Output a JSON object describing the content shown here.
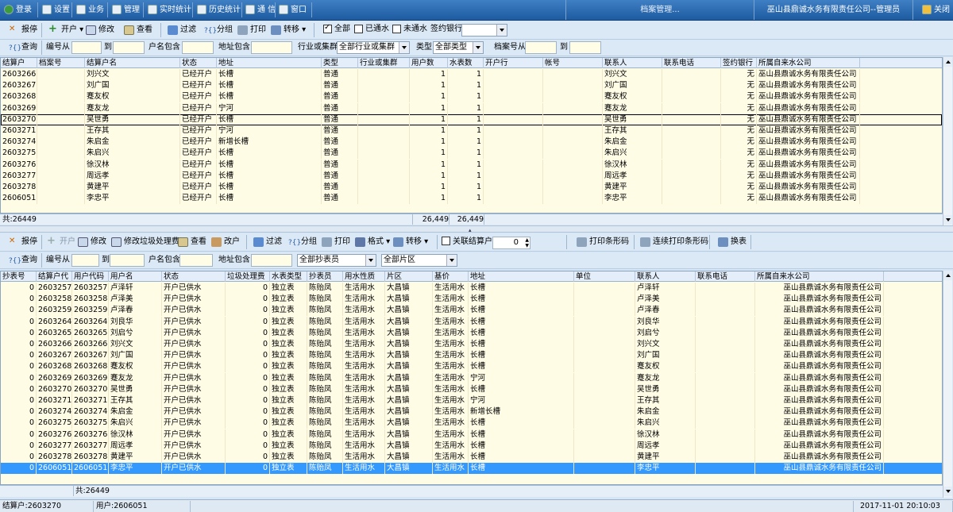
{
  "menu": {
    "login": "登录",
    "settings": "设置",
    "business": "业务",
    "manage": "管理",
    "realtime": "实时统计",
    "history": "历史统计",
    "comm": "通 信",
    "window": "窗口",
    "title": "档案管理...",
    "user": "巫山县鼎诚水务有限责任公司--管理员",
    "close": "关闭"
  },
  "top_toolbar": {
    "report_stop": "报停",
    "open": "开户",
    "modify": "修改",
    "view": "查看",
    "filter": "过滤",
    "group": "分组",
    "print": "打印",
    "transfer": "转移",
    "all": "全部",
    "connected": "已通水",
    "not_connected": "未通水",
    "sign_bank": "签约银行"
  },
  "top_query": {
    "query": "查询",
    "num_from": "编号从",
    "to": "到",
    "name_contains": "户名包含",
    "addr_contains": "地址包含",
    "industry": "行业或集群",
    "industry_value": "全部行业或集群",
    "type": "类型",
    "type_value": "全部类型",
    "archive_from": "档案号从",
    "to2": "到"
  },
  "top_grid": {
    "columns": [
      "结算户",
      "档案号",
      "结算户名",
      "状态",
      "地址",
      "类型",
      "行业或集群",
      "用户数",
      "水表数",
      "开户行",
      "帐号",
      "联系人",
      "联系电话",
      "签约银行",
      "所属自来水公司"
    ],
    "rows": [
      [
        "2603266",
        "",
        "刘兴文",
        "已经开户",
        "长槽",
        "普通",
        "",
        "1",
        "1",
        "",
        "",
        "刘兴文",
        "",
        "无",
        "巫山县鼎诚水务有限责任公司"
      ],
      [
        "2603267",
        "",
        "刘广国",
        "已经开户",
        "长槽",
        "普通",
        "",
        "1",
        "1",
        "",
        "",
        "刘广国",
        "",
        "无",
        "巫山县鼎诚水务有限责任公司"
      ],
      [
        "2603268",
        "",
        "蹇友权",
        "已经开户",
        "长槽",
        "普通",
        "",
        "1",
        "1",
        "",
        "",
        "蹇友权",
        "",
        "无",
        "巫山县鼎诚水务有限责任公司"
      ],
      [
        "2603269",
        "",
        "蹇友龙",
        "已经开户",
        "宁河",
        "普通",
        "",
        "1",
        "1",
        "",
        "",
        "蹇友龙",
        "",
        "无",
        "巫山县鼎诚水务有限责任公司"
      ],
      [
        "2603270",
        "",
        "吴世勇",
        "已经开户",
        "长槽",
        "普通",
        "",
        "1",
        "1",
        "",
        "",
        "吴世勇",
        "",
        "无",
        "巫山县鼎诚水务有限责任公司"
      ],
      [
        "2603271",
        "",
        "王存其",
        "已经开户",
        "宁河",
        "普通",
        "",
        "1",
        "1",
        "",
        "",
        "王存其",
        "",
        "无",
        "巫山县鼎诚水务有限责任公司"
      ],
      [
        "2603274",
        "",
        "朱启金",
        "已经开户",
        "新增长槽",
        "普通",
        "",
        "1",
        "1",
        "",
        "",
        "朱启金",
        "",
        "无",
        "巫山县鼎诚水务有限责任公司"
      ],
      [
        "2603275",
        "",
        "朱启兴",
        "已经开户",
        "长槽",
        "普通",
        "",
        "1",
        "1",
        "",
        "",
        "朱启兴",
        "",
        "无",
        "巫山县鼎诚水务有限责任公司"
      ],
      [
        "2603276",
        "",
        "徐汉林",
        "已经开户",
        "长槽",
        "普通",
        "",
        "1",
        "1",
        "",
        "",
        "徐汉林",
        "",
        "无",
        "巫山县鼎诚水务有限责任公司"
      ],
      [
        "2603277",
        "",
        "周远孝",
        "已经开户",
        "长槽",
        "普通",
        "",
        "1",
        "1",
        "",
        "",
        "周远孝",
        "",
        "无",
        "巫山县鼎诚水务有限责任公司"
      ],
      [
        "2603278",
        "",
        "黄建平",
        "已经开户",
        "长槽",
        "普通",
        "",
        "1",
        "1",
        "",
        "",
        "黄建平",
        "",
        "无",
        "巫山县鼎诚水务有限责任公司"
      ],
      [
        "2606051",
        "",
        "李忠平",
        "已经开户",
        "长槽",
        "普通",
        "",
        "1",
        "1",
        "",
        "",
        "李忠平",
        "",
        "无",
        "巫山县鼎诚水务有限责任公司"
      ]
    ],
    "footer_count": "共:26449",
    "footer_users": "26,449",
    "footer_meters": "26,449"
  },
  "bottom_toolbar": {
    "report_stop": "报停",
    "open": "开户",
    "modify": "修改",
    "modify_garbage": "修改垃圾处理费",
    "view": "查看",
    "change_user": "改户",
    "filter": "过滤",
    "group": "分组",
    "print": "打印",
    "format": "格式",
    "transfer": "转移",
    "link_account": "关联结算户",
    "link_value": "0",
    "print_barcode": "打印条形码",
    "batch_barcode": "连续打印条形码",
    "swap": "换表"
  },
  "bottom_query": {
    "query": "查询",
    "num_from": "编号从",
    "to": "到",
    "name_contains": "户名包含",
    "addr_contains": "地址包含",
    "readers": "全部抄表员",
    "areas": "全部片区"
  },
  "bottom_grid": {
    "columns": [
      "抄表号",
      "结算户代",
      "用户代码",
      "用户名",
      "状态",
      "垃圾处理费",
      "水表类型",
      "抄表员",
      "用水性质",
      "片区",
      "基价",
      "地址",
      "单位",
      "联系人",
      "联系电话",
      "所属自来水公司"
    ],
    "rows": [
      [
        "0",
        "2603257",
        "2603257",
        "卢泽轩",
        "开户已供水",
        "0",
        "独立表",
        "陈贻凤",
        "生活用水",
        "大昌镇",
        "生活用水",
        "长槽",
        "",
        "卢泽轩",
        "",
        "巫山县鼎诚水务有限责任公司"
      ],
      [
        "0",
        "2603258",
        "2603258",
        "卢泽美",
        "开户已供水",
        "0",
        "独立表",
        "陈贻凤",
        "生活用水",
        "大昌镇",
        "生活用水",
        "长槽",
        "",
        "卢泽美",
        "",
        "巫山县鼎诚水务有限责任公司"
      ],
      [
        "0",
        "2603259",
        "2603259",
        "卢泽春",
        "开户已供水",
        "0",
        "独立表",
        "陈贻凤",
        "生活用水",
        "大昌镇",
        "生活用水",
        "长槽",
        "",
        "卢泽春",
        "",
        "巫山县鼎诚水务有限责任公司"
      ],
      [
        "0",
        "2603264",
        "2603264",
        "刘良华",
        "开户已供水",
        "0",
        "独立表",
        "陈贻凤",
        "生活用水",
        "大昌镇",
        "生活用水",
        "长槽",
        "",
        "刘良华",
        "",
        "巫山县鼎诚水务有限责任公司"
      ],
      [
        "0",
        "2603265",
        "2603265",
        "刘启兮",
        "开户已供水",
        "0",
        "独立表",
        "陈贻凤",
        "生活用水",
        "大昌镇",
        "生活用水",
        "长槽",
        "",
        "刘启兮",
        "",
        "巫山县鼎诚水务有限责任公司"
      ],
      [
        "0",
        "2603266",
        "2603266",
        "刘兴文",
        "开户已供水",
        "0",
        "独立表",
        "陈贻凤",
        "生活用水",
        "大昌镇",
        "生活用水",
        "长槽",
        "",
        "刘兴文",
        "",
        "巫山县鼎诚水务有限责任公司"
      ],
      [
        "0",
        "2603267",
        "2603267",
        "刘广国",
        "开户已供水",
        "0",
        "独立表",
        "陈贻凤",
        "生活用水",
        "大昌镇",
        "生活用水",
        "长槽",
        "",
        "刘广国",
        "",
        "巫山县鼎诚水务有限责任公司"
      ],
      [
        "0",
        "2603268",
        "2603268",
        "蹇友权",
        "开户已供水",
        "0",
        "独立表",
        "陈贻凤",
        "生活用水",
        "大昌镇",
        "生活用水",
        "长槽",
        "",
        "蹇友权",
        "",
        "巫山县鼎诚水务有限责任公司"
      ],
      [
        "0",
        "2603269",
        "2603269",
        "蹇友龙",
        "开户已供水",
        "0",
        "独立表",
        "陈贻凤",
        "生活用水",
        "大昌镇",
        "生活用水",
        "宁河",
        "",
        "蹇友龙",
        "",
        "巫山县鼎诚水务有限责任公司"
      ],
      [
        "0",
        "2603270",
        "2603270",
        "吴世勇",
        "开户已供水",
        "0",
        "独立表",
        "陈贻凤",
        "生活用水",
        "大昌镇",
        "生活用水",
        "长槽",
        "",
        "吴世勇",
        "",
        "巫山县鼎诚水务有限责任公司"
      ],
      [
        "0",
        "2603271",
        "2603271",
        "王存其",
        "开户已供水",
        "0",
        "独立表",
        "陈贻凤",
        "生活用水",
        "大昌镇",
        "生活用水",
        "宁河",
        "",
        "王存其",
        "",
        "巫山县鼎诚水务有限责任公司"
      ],
      [
        "0",
        "2603274",
        "2603274",
        "朱启金",
        "开户已供水",
        "0",
        "独立表",
        "陈贻凤",
        "生活用水",
        "大昌镇",
        "生活用水",
        "新增长槽",
        "",
        "朱启金",
        "",
        "巫山县鼎诚水务有限责任公司"
      ],
      [
        "0",
        "2603275",
        "2603275",
        "朱启兴",
        "开户已供水",
        "0",
        "独立表",
        "陈贻凤",
        "生活用水",
        "大昌镇",
        "生活用水",
        "长槽",
        "",
        "朱启兴",
        "",
        "巫山县鼎诚水务有限责任公司"
      ],
      [
        "0",
        "2603276",
        "2603276",
        "徐汉林",
        "开户已供水",
        "0",
        "独立表",
        "陈贻凤",
        "生活用水",
        "大昌镇",
        "生活用水",
        "长槽",
        "",
        "徐汉林",
        "",
        "巫山县鼎诚水务有限责任公司"
      ],
      [
        "0",
        "2603277",
        "2603277",
        "周远孝",
        "开户已供水",
        "0",
        "独立表",
        "陈贻凤",
        "生活用水",
        "大昌镇",
        "生活用水",
        "长槽",
        "",
        "周远孝",
        "",
        "巫山县鼎诚水务有限责任公司"
      ],
      [
        "0",
        "2603278",
        "2603278",
        "黄建平",
        "开户已供水",
        "0",
        "独立表",
        "陈贻凤",
        "生活用水",
        "大昌镇",
        "生活用水",
        "长槽",
        "",
        "黄建平",
        "",
        "巫山县鼎诚水务有限责任公司"
      ],
      [
        "0",
        "2606051",
        "2606051",
        "李忠平",
        "开户已供水",
        "0",
        "独立表",
        "陈贻凤",
        "生活用水",
        "大昌镇",
        "生活用水",
        "长槽",
        "",
        "李忠平",
        "",
        "巫山县鼎诚水务有限责任公司"
      ]
    ],
    "footer_count": "共:26449"
  },
  "status": {
    "account": "结算户:2603270",
    "user": "用户:2606051",
    "datetime": "2017-11-01 20:10:03"
  },
  "colors": {
    "menubar": "#2e6db4",
    "grid_bg": "#fffce6",
    "selected": "#3399ff"
  }
}
